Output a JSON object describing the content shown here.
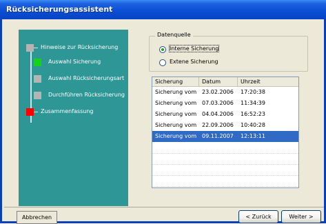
{
  "window": {
    "title": "Rücksicherungsassistent"
  },
  "steps": [
    {
      "label": "Hinweise zur Rücksicherung",
      "state": "done"
    },
    {
      "label": "Auswahl Sicherung",
      "state": "current"
    },
    {
      "label": "Auswahl Rücksicherungsart",
      "state": "pending"
    },
    {
      "label": "Durchführen Rücksicherung",
      "state": "pending"
    },
    {
      "label": "Zusammenfassung",
      "state": "error"
    }
  ],
  "datasource": {
    "legend": "Datenquelle",
    "options": [
      {
        "label": "Interne Sicherung",
        "selected": true
      },
      {
        "label": "Extene Sicherung",
        "selected": false
      }
    ]
  },
  "backups": {
    "columns": [
      "Sicherung",
      "Datum",
      "Uhrzeit"
    ],
    "rows": [
      {
        "name": "Sicherung vom",
        "date": "23.02.2006",
        "time": "17:20:38",
        "selected": false
      },
      {
        "name": "Sicherung vom",
        "date": "07.03.2006",
        "time": "11:34:39",
        "selected": false
      },
      {
        "name": "Sicherung vom",
        "date": "04.04.2006",
        "time": "16:52:23",
        "selected": false
      },
      {
        "name": "Sicherung vom",
        "date": "22.09.2006",
        "time": "10:40:28",
        "selected": false
      },
      {
        "name": "Sicherung vom",
        "date": "09.11.2007",
        "time": "12:13:11",
        "selected": true
      }
    ]
  },
  "buttons": {
    "cancel": "Abbrechen",
    "back": "< Zurück",
    "next": "Weiter >"
  },
  "colors": {
    "title_bar": "#0a4fd5",
    "side_panel": "#2e9694",
    "step_done": "#b4b4b4",
    "step_current": "#14d214",
    "step_error": "#ff0000",
    "selection": "#316ac5"
  }
}
